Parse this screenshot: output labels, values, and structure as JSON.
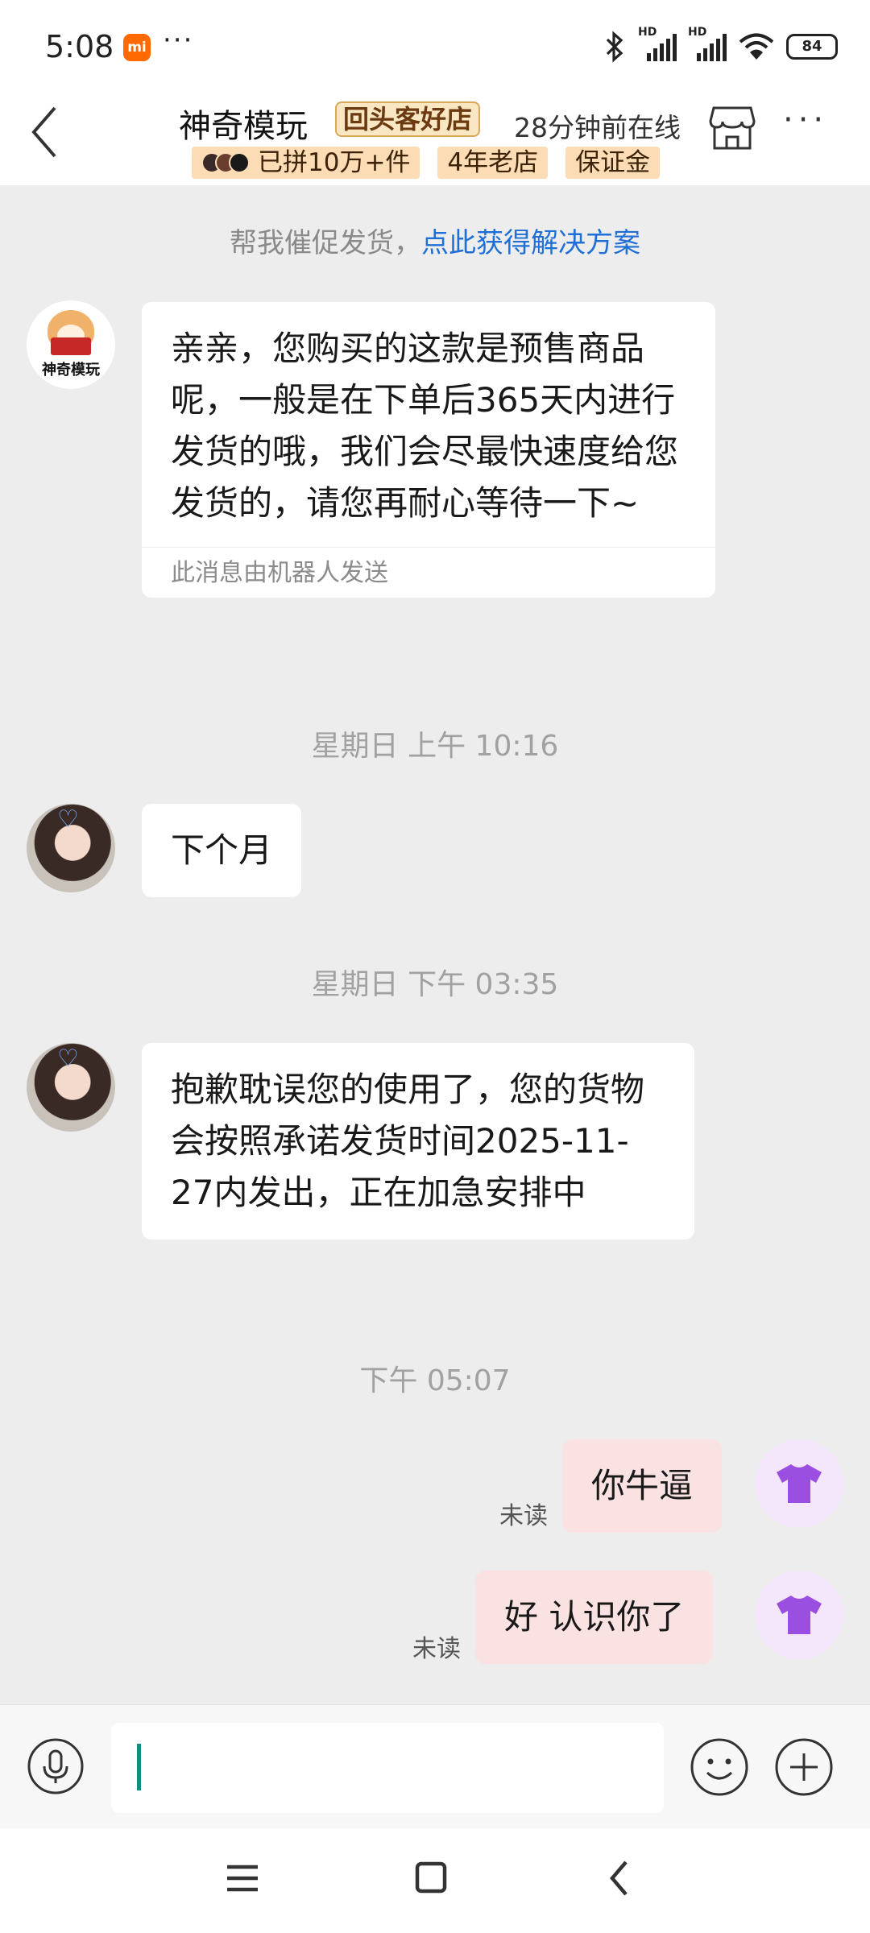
{
  "status_bar": {
    "time": "5:08",
    "mi_badge": "mi",
    "more_dots": "···",
    "signal1_label": "HD",
    "signal2_label": "HD",
    "battery": "84"
  },
  "header": {
    "shop_name": "神奇模玩",
    "repeat_badge": "回头客好店",
    "online_status": "28分钟前在线",
    "tags": {
      "sold": "已拼10万+件",
      "years": "4年老店",
      "deposit": "保证金"
    }
  },
  "chat": {
    "notice_text": "帮我催促发货，",
    "notice_link": "点此获得解决方案",
    "shop_avatar_label": "神奇模玩",
    "messages": {
      "m1": {
        "text": "亲亲，您购买的这款是预售商品呢，一般是在下单后365天内进行发货的哦，我们会尽最快速度给您发货的，请您再耐心等待一下~",
        "note": "此消息由机器人发送"
      },
      "t1": "星期日 上午 10:16",
      "m2": {
        "text": "下个月"
      },
      "t2": "星期日 下午 03:35",
      "m3": {
        "text": "抱歉耽误您的使用了，您的货物会按照承诺发货时间2025-11-27内发出，正在加急安排中"
      },
      "t3": "下午 05:07",
      "m4": {
        "text": "你牛逼",
        "status": "未读"
      },
      "m5": {
        "text": "好 认识你了",
        "status": "未读"
      }
    }
  },
  "input_bar": {
    "placeholder": ""
  },
  "colors": {
    "accent_link": "#1f6fd6",
    "my_bubble": "#fbe2e2",
    "tag_bg": "#fbdcb4",
    "caret": "#0d8f86"
  },
  "icons": {
    "back": "chevron-left-icon",
    "store": "store-icon",
    "more": "more-icon",
    "voice": "microphone-icon",
    "emoji": "smile-icon",
    "plus": "plus-icon",
    "nav_menu": "menu-icon",
    "nav_home": "square-icon",
    "nav_back": "chevron-left-icon"
  }
}
